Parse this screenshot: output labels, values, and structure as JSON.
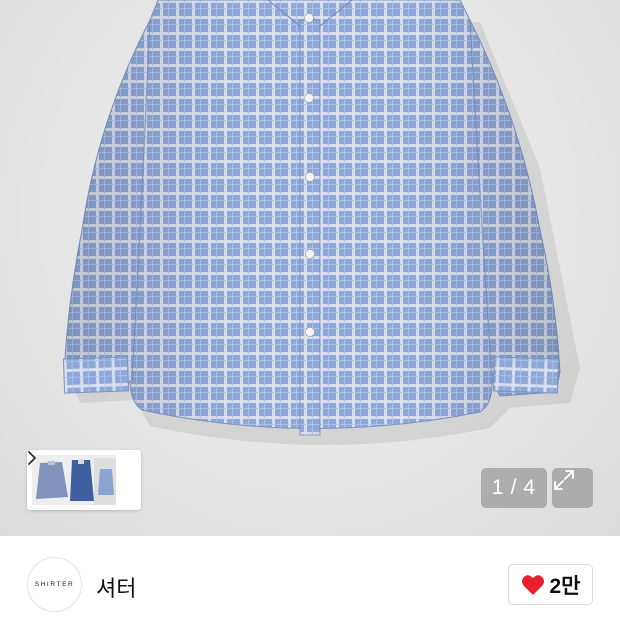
{
  "product_gallery": {
    "image_alt_name": "blue-check-shirt",
    "counter": {
      "current": "1",
      "separator": "/",
      "total": "4"
    },
    "thumbnail_count": 3
  },
  "brand": {
    "logo_text": "SHIRTER",
    "name": "셔터"
  },
  "like": {
    "count": "2만",
    "heart_color": "#e8202c"
  },
  "colors": {
    "shirt_base": "#8fa9d8",
    "shirt_grid": "#dfe3ee",
    "background": "#e6e6e6"
  }
}
